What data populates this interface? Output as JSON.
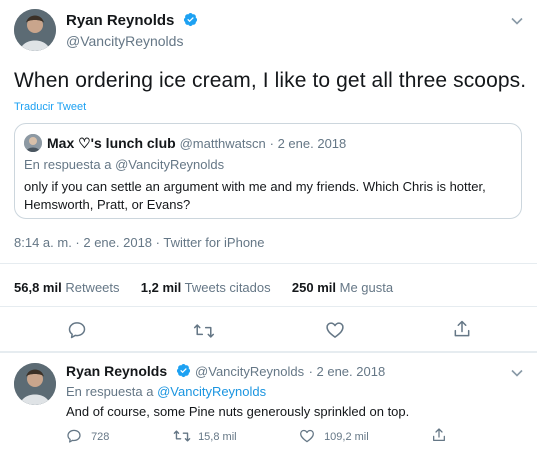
{
  "main_tweet": {
    "author_name": "Ryan Reynolds",
    "author_handle": "@VancityReynolds",
    "text": "When ordering ice cream, I like to get all three scoops.",
    "translate_label": "Traducir Tweet",
    "quoted": {
      "author_name": "Max ♡'s lunch club",
      "author_handle": "@matthwatscn",
      "date": "· 2 ene. 2018",
      "reply_to_prefix": "En respuesta a",
      "reply_to_handle": "@VancityReynolds",
      "text_line1": "only if you can settle an argument with me and my friends. Which Chris is hotter,",
      "text_line2": "Hemsworth, Pratt, or Evans?"
    },
    "timestamp": "8:14 a. m. · 2 ene. 2018 · Twitter for iPhone",
    "stats": {
      "retweets_count": "56,8 mil",
      "retweets_label": "Retweets",
      "quotes_count": "1,2 mil",
      "quotes_label": "Tweets citados",
      "likes_count": "250 mil",
      "likes_label": "Me gusta"
    }
  },
  "reply_tweet": {
    "author_name": "Ryan Reynolds",
    "author_handle": "@VancityReynolds",
    "date": "· 2 ene. 2018",
    "reply_to_prefix": "En respuesta a",
    "reply_to_handle": "@VancityReynolds",
    "text": "And of course, some Pine nuts generously sprinkled on top.",
    "replies": "728",
    "retweets": "15,8 mil",
    "likes": "109,2 mil"
  },
  "icons": {
    "more": "chevron-down-icon",
    "verified": "verified-badge-icon",
    "reply": "reply-icon",
    "retweet": "retweet-icon",
    "like": "heart-icon",
    "share": "share-icon"
  },
  "colors": {
    "accent": "#1da1f2",
    "link": "#1b95e0",
    "muted": "#657786",
    "text": "#14171a",
    "border": "#e6ecf0"
  }
}
